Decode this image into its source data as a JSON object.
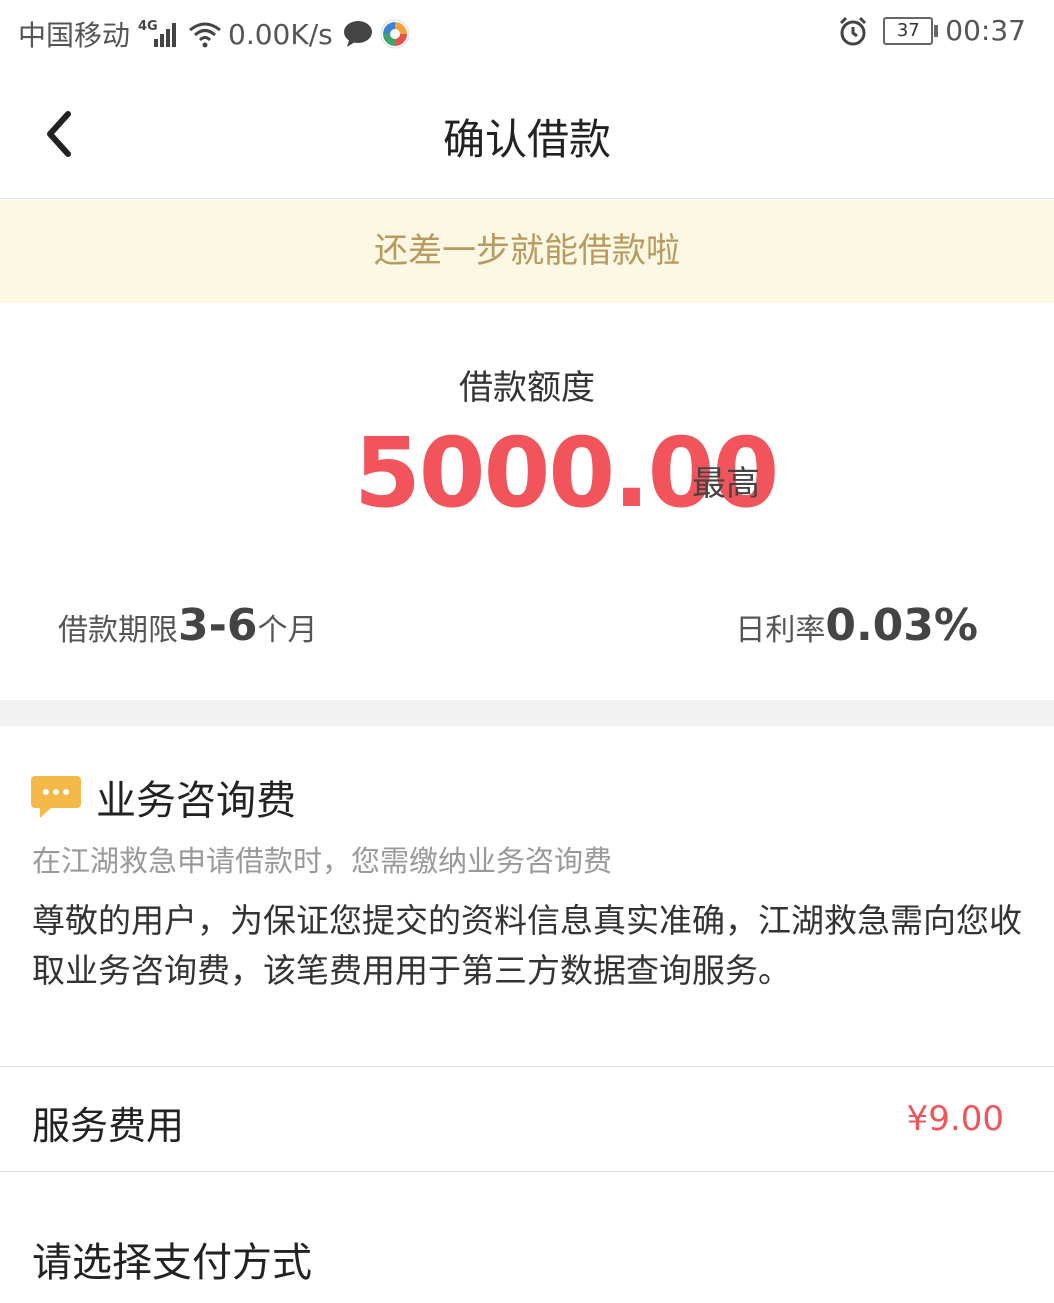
{
  "status_bar": {
    "carrier": "中国移动",
    "network": "4G",
    "speed": "0.00K/s",
    "battery": "37",
    "time": "00:37"
  },
  "nav": {
    "title": "确认借款"
  },
  "notice": "还差一步就能借款啦",
  "loan": {
    "amount_label": "借款额度",
    "amount": "5000.00",
    "amount_suffix": "最高",
    "term_label": "借款期限",
    "term_value": "3-6",
    "term_unit": "个月",
    "rate_label": "日利率",
    "rate_value": "0.03%"
  },
  "fee": {
    "title": "业务咨询费",
    "subtitle": "在江湖救急申请借款时，您需缴纳业务咨询费",
    "description": "尊敬的用户，为保证您提交的资料信息真实准确，江湖救急需向您收取业务咨询费，该笔费用用于第三方数据查询服务。"
  },
  "service": {
    "label": "服务费用",
    "value": "¥9.00"
  },
  "payment": {
    "label": "请选择支付方式"
  },
  "colors": {
    "accent_red": "#f2545b",
    "notice_bg": "#fcf8e3",
    "notice_text": "#b89a5f",
    "icon_yellow": "#f5b94a"
  },
  "icons": [
    "back-arrow-icon",
    "signal-icon",
    "wifi-icon",
    "chat-icon",
    "app-icon",
    "alarm-icon",
    "battery-icon",
    "message-bubble-icon"
  ]
}
